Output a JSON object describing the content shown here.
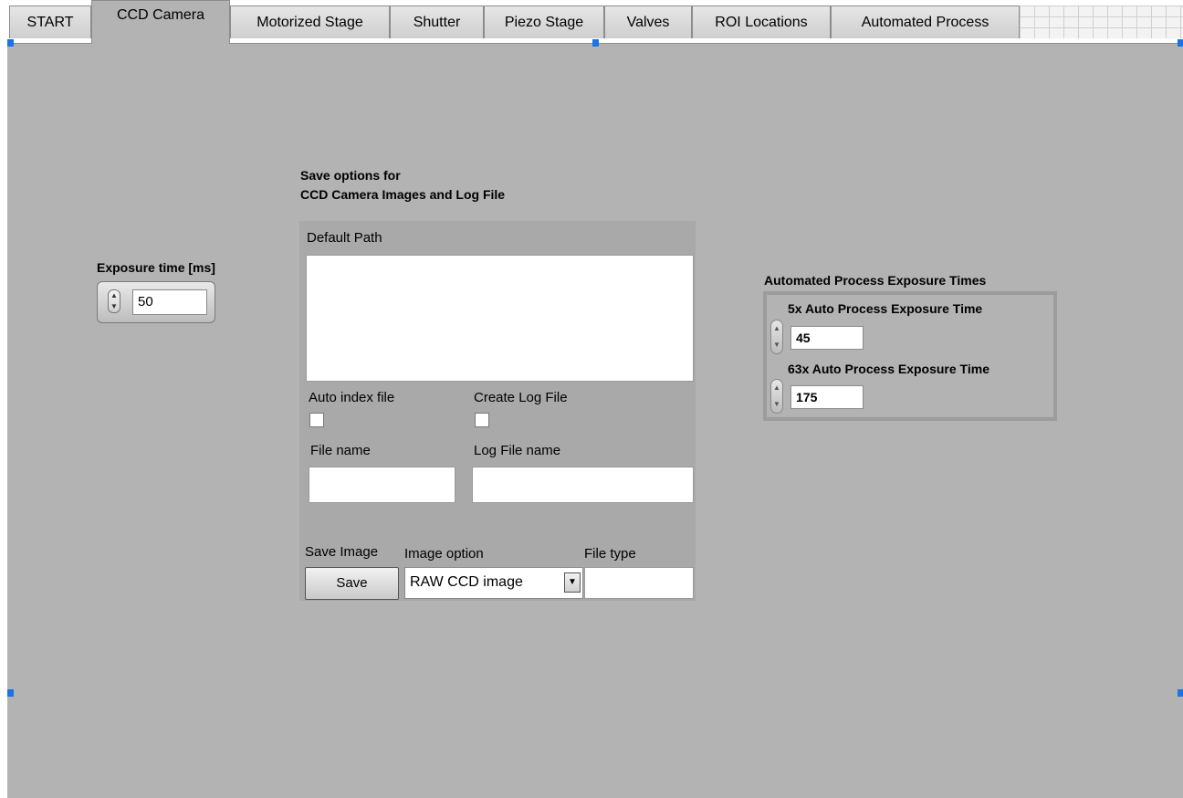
{
  "tabs": [
    {
      "label": "START",
      "active": false
    },
    {
      "label": "CCD Camera",
      "active": true
    },
    {
      "label": "Motorized Stage",
      "active": false
    },
    {
      "label": "Shutter",
      "active": false
    },
    {
      "label": "Piezo Stage",
      "active": false
    },
    {
      "label": "Valves",
      "active": false
    },
    {
      "label": "ROI Locations",
      "active": false
    },
    {
      "label": "Automated Process",
      "active": false
    }
  ],
  "exposure": {
    "label": "Exposure time [ms]",
    "value": "50"
  },
  "save_options": {
    "title_line1": "Save options for",
    "title_line2": "CCD Camera Images and Log File",
    "default_path_label": "Default Path",
    "default_path_value": "",
    "auto_index_label": "Auto index file",
    "auto_index_checked": false,
    "create_log_label": "Create Log File",
    "create_log_checked": false,
    "file_name_label": "File name",
    "file_name_value": "",
    "log_file_name_label": "Log File name",
    "log_file_name_value": "",
    "save_image_label": "Save Image",
    "save_button": "Save",
    "image_option_label": "Image option",
    "image_option_value": "RAW CCD image",
    "file_type_label": "File type",
    "file_type_value": ""
  },
  "auto_exposure": {
    "title": "Automated Process Exposure Times",
    "x5_label": "5x Auto Process Exposure Time",
    "x5_value": "45",
    "x63_label": "63x Auto Process Exposure Time",
    "x63_value": "175"
  },
  "colors": {
    "panel": "#b3b3b3",
    "selection_handle": "#1a73e8"
  }
}
